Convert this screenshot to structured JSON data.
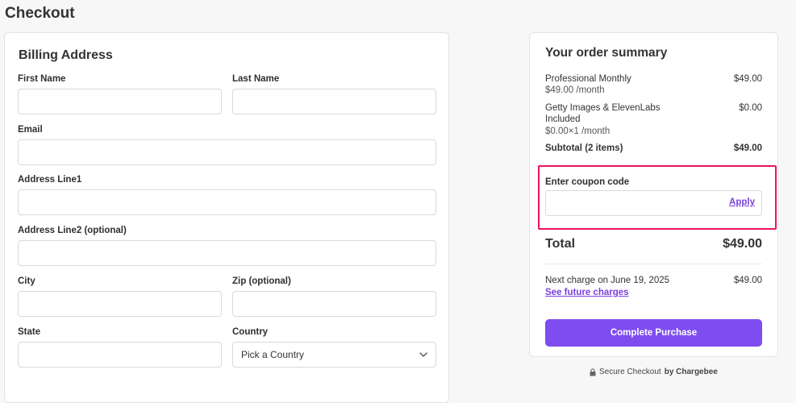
{
  "page": {
    "title": "Checkout"
  },
  "billing": {
    "title": "Billing Address",
    "first_name_label": "First Name",
    "last_name_label": "Last Name",
    "email_label": "Email",
    "address1_label": "Address Line1",
    "address2_label": "Address Line2 (optional)",
    "city_label": "City",
    "zip_label": "Zip (optional)",
    "state_label": "State",
    "country_label": "Country",
    "country_value": "Pick a Country"
  },
  "summary": {
    "title": "Your order summary",
    "items": [
      {
        "name": "Professional Monthly",
        "detail": "$49.00 /month",
        "price": "$49.00"
      },
      {
        "name": "Getty Images & ElevenLabs",
        "name2": "Included",
        "detail": "$0.00×1 /month",
        "price": "$0.00"
      }
    ],
    "subtotal_label": "Subtotal (2 items)",
    "subtotal_value": "$49.00",
    "coupon_label": "Enter coupon code",
    "coupon_value": "",
    "apply_label": "Apply",
    "total_label": "Total",
    "total_value": "$49.00",
    "next_charge_label": "Next charge on June 19, 2025",
    "next_charge_value": "$49.00",
    "future_charges_link": "See future charges",
    "purchase_button": "Complete Purchase"
  },
  "footer": {
    "secure_text": "Secure Checkout",
    "by_text": "by Chargebee"
  },
  "colors": {
    "accent": "#7f4cf0",
    "highlight": "#e8155e"
  }
}
